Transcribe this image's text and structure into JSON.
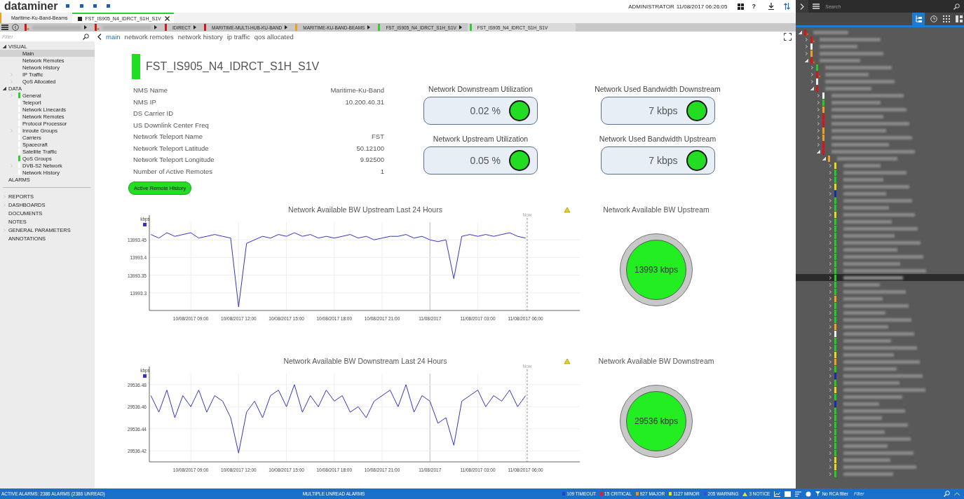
{
  "header": {
    "logo": "dataminer",
    "user": "ADMINISTRATOR",
    "datetime": "11/08/2017 06:26:05",
    "help": "?"
  },
  "tabs": [
    {
      "label": "Maritime-Ku-Band-Beams",
      "color": "#f0a020",
      "selected": false
    },
    {
      "label": "FST_IS905_N4_IDRCT_S1H_S1V",
      "color": "#33cc33",
      "selected": true
    }
  ],
  "breadcrumbs": [
    {
      "color": "#d01818",
      "alarm": true,
      "selected": false
    },
    {
      "color": "#d01818",
      "alarm": true,
      "selected": false
    },
    {
      "label": "IDIRECT",
      "color": "#d01818",
      "alarm": false,
      "selected": false
    },
    {
      "label": "MARITIME-MULTI-HUB-KU-BAND",
      "color": "#d01818",
      "alarm": false,
      "selected": false
    },
    {
      "label": "MARITIME-KU-BAND-BEAMS",
      "color": "#f0a020",
      "alarm": false,
      "selected": false
    },
    {
      "label": "FST_IS905_N4_IDRCT_S1H_S1V",
      "color": "#33cc33",
      "alarm": false,
      "selected": false
    },
    {
      "label": "FST_IS905_N4_IDRCT_S1H_S1V",
      "color": "#33cc33",
      "alarm": false,
      "selected": true
    }
  ],
  "sidebar": {
    "filter": {
      "placeholder": "Filter"
    },
    "tree": [
      {
        "label": "VISUAL",
        "expanded": true,
        "selected": false,
        "children": [
          {
            "label": "Main",
            "expandable": false,
            "selected": true
          },
          {
            "label": "Network Remotes",
            "expandable": false,
            "selected": false
          },
          {
            "label": "Network History",
            "expandable": false,
            "selected": false
          },
          {
            "label": "IP Traffic",
            "expandable": true,
            "selected": false
          },
          {
            "label": "QoS Allocated",
            "expandable": true,
            "selected": false
          }
        ]
      },
      {
        "label": "DATA",
        "expanded": true,
        "selected": false,
        "children": [
          {
            "label": "General",
            "color": "#33cc33",
            "expandable": true,
            "selected": false
          },
          {
            "label": "Teleport",
            "color": "#ffffff",
            "expandable": false,
            "selected": false
          },
          {
            "label": "Network Linecards",
            "color": "#ffffff",
            "expandable": false,
            "selected": false
          },
          {
            "label": "Network Remotes",
            "color": "#ffffff",
            "expandable": false,
            "selected": false
          },
          {
            "label": "Protocol Processor",
            "color": "#ffffff",
            "expandable": false,
            "selected": false
          },
          {
            "label": "Inroute Groups",
            "color": "#ffffff",
            "expandable": true,
            "selected": false
          },
          {
            "label": "Carriers",
            "color": "#ffffff",
            "expandable": false,
            "selected": false
          },
          {
            "label": "Spacecraft",
            "color": "#ffffff",
            "expandable": false,
            "selected": false
          },
          {
            "label": "Satellite Traffic",
            "color": "#ffffff",
            "expandable": false,
            "selected": false
          },
          {
            "label": "QoS Groups",
            "color": "#33cc33",
            "expandable": false,
            "selected": false
          },
          {
            "label": "DVB-S2 Network",
            "color": "#ffffff",
            "expandable": true,
            "selected": false
          },
          {
            "label": "Network History",
            "color": "#ffffff",
            "expandable": false,
            "selected": false
          }
        ]
      },
      {
        "label": "ALARMS",
        "expandable": false,
        "selected": false
      }
    ],
    "sections": [
      {
        "label": "REPORTS",
        "expandable": true,
        "selected": false
      },
      {
        "label": "DASHBOARDS",
        "expandable": true,
        "selected": false
      },
      {
        "label": "DOCUMENTS",
        "expandable": false,
        "selected": false
      },
      {
        "label": "NOTES",
        "expandable": false,
        "selected": false
      },
      {
        "label": "GENERAL PARAMETERS",
        "expandable": true,
        "selected": false
      },
      {
        "label": "ANNOTATIONS",
        "expandable": false,
        "selected": false
      }
    ]
  },
  "page_tabs": [
    {
      "label": "main",
      "selected": true
    },
    {
      "label": "network remotes",
      "selected": false
    },
    {
      "label": "network history",
      "selected": false
    },
    {
      "label": "ip traffic",
      "selected": false
    },
    {
      "label": "qos allocated",
      "selected": false
    }
  ],
  "element": {
    "title": "FST_IS905_N4_IDRCT_S1H_S1V",
    "color": "#22dd22"
  },
  "parameters": [
    {
      "name": "NMS Name",
      "value": "Maritime-Ku-Band"
    },
    {
      "name": "NMS IP",
      "value": "10.200.40.31"
    },
    {
      "name": "DS Carrier ID"
    },
    {
      "name": "US Downlink Center Freq"
    },
    {
      "name": "Network Teleport Name",
      "value": "FST"
    },
    {
      "name": "Network Teleport Latitude",
      "value": "50.12100"
    },
    {
      "name": "Network Teleport Longitude",
      "value": "9.92500"
    },
    {
      "name": "Number of Active Remotes",
      "value": "1"
    }
  ],
  "button": "Active Remote History",
  "readouts": [
    {
      "title": "Network Downstream Utilization",
      "value": "0.02 %",
      "color": "#22dd22"
    },
    {
      "title": "Network Used Bandwidth Downstream",
      "value": "7 kbps",
      "color": "#22dd22"
    },
    {
      "title": "Network Upstream Utilization",
      "value": "0.05 %",
      "color": "#22dd22"
    },
    {
      "title": "Network Used Bandwidth Upstream",
      "value": "7 kbps",
      "color": "#22dd22"
    }
  ],
  "trends": [
    {
      "chart_data": {
        "type": "line",
        "title": "Network Available BW Upstream Last 24 Hours",
        "categories": [
          null,
          null,
          null,
          null,
          null,
          "10/08/2017 09:00",
          null,
          null,
          null,
          null,
          null,
          "10/08/2017 12:00",
          null,
          null,
          null,
          null,
          null,
          "10/08/2017 15:00",
          null,
          null,
          null,
          null,
          null,
          "10/08/2017 18:00",
          null,
          null,
          null,
          null,
          null,
          "10/08/2017 21:00",
          null,
          null,
          null,
          null,
          null,
          "11/08/2017",
          null,
          null,
          null,
          null,
          null,
          "11/08/2017 03:00",
          null,
          null,
          null,
          null,
          null,
          "11/08/2017 06:00"
        ],
        "series": [
          {
            "name": "kbps",
            "color": "#3333cc",
            "values": [
              13993.465,
              13993.455,
              13993.47,
              13993.46,
              13993.465,
              13993.47,
              13993.455,
              13993.46,
              13993.465,
              13993.46,
              13993.455,
              13993.26,
              13993.44,
              13993.45,
              13993.46,
              13993.455,
              13993.465,
              13993.46,
              13993.47,
              13993.46,
              13993.465,
              13993.455,
              13993.46,
              13993.455,
              13993.46,
              13993.465,
              13993.455,
              13993.46,
              13993.45,
              13993.455,
              13993.46,
              13993.46,
              13993.465,
              13993.455,
              13993.46,
              13993.45,
              13993.445,
              13993.45,
              13993.34,
              13993.46,
              13993.465,
              13993.46,
              13993.465,
              13993.46,
              13993.465,
              13993.47,
              13993.46,
              13993.455
            ]
          }
        ],
        "ylim": [
          13993.25,
          13993.5
        ],
        "yticks": [
          13993.3,
          13993.35,
          13993.4,
          13993.45
        ],
        "grid": true,
        "annotations": [
          "Now"
        ]
      }
    },
    {
      "chart_data": {
        "type": "line",
        "title": "Network Available BW Downstream Last 24 Hours",
        "categories": [
          null,
          null,
          null,
          null,
          null,
          "10/08/2017 09:00",
          null,
          null,
          null,
          null,
          null,
          "10/08/2017 12:00",
          null,
          null,
          null,
          null,
          null,
          "10/08/2017 15:00",
          null,
          null,
          null,
          null,
          null,
          "10/08/2017 18:00",
          null,
          null,
          null,
          null,
          null,
          "10/08/2017 21:00",
          null,
          null,
          null,
          null,
          null,
          "11/08/2017",
          null,
          null,
          null,
          null,
          null,
          "11/08/2017 03:00",
          null,
          null,
          null,
          null,
          null,
          "11/08/2017 06:00"
        ],
        "series": [
          {
            "name": "kbps",
            "color": "#3333cc",
            "values": [
              29536.47,
              29536.455,
              29536.475,
              29536.45,
              29536.47,
              29536.46,
              29536.475,
              29536.455,
              29536.47,
              29536.465,
              29536.45,
              29536.418,
              29536.455,
              29536.465,
              29536.45,
              29536.47,
              29536.475,
              29536.46,
              29536.48,
              29536.455,
              29536.47,
              29536.46,
              29536.475,
              29536.465,
              29536.47,
              29536.455,
              29536.46,
              29536.45,
              29536.465,
              29536.47,
              29536.475,
              29536.46,
              29536.48,
              29536.455,
              29536.47,
              29536.465,
              29536.445,
              29536.45,
              29536.425,
              29536.465,
              29536.47,
              29536.475,
              29536.46,
              29536.47,
              29536.465,
              29536.475,
              29536.46,
              29536.47
            ]
          }
        ],
        "ylim": [
          29536.41,
          29536.49
        ],
        "yticks": [
          29536.42,
          29536.44,
          29536.46,
          29536.48
        ],
        "grid": true,
        "annotations": [
          "Now"
        ]
      }
    }
  ],
  "gauges": [
    {
      "title": "Network Available BW Upstream",
      "value": "13993 kbps",
      "color": "#22ee22"
    },
    {
      "title": "Network Available BW Downstream",
      "value": "29536 kbps",
      "color": "#22ee22"
    }
  ],
  "navigator": {
    "search": {
      "placeholder": "Search"
    },
    "tree": [
      {
        "color": "#d01818",
        "alarm": true,
        "expanded": true,
        "selected": false,
        "children": [
          {
            "color": "#d01818",
            "alarm": true,
            "expanded": false,
            "selected": false
          },
          {
            "color": "#f0f0f0",
            "alarm": false,
            "expanded": false,
            "selected": false
          },
          {
            "color": "#f0a020",
            "alarm": false,
            "expanded": false,
            "selected": false
          },
          {
            "color": "#d01818",
            "alarm": true,
            "expanded": true,
            "selected": false,
            "children": [
              {
                "color": "#22cc22",
                "alarm": false,
                "expanded": false,
                "selected": false
              },
              {
                "color": "#d01818",
                "alarm": true,
                "expanded": false,
                "selected": false
              },
              {
                "color": "#f0f0f0",
                "alarm": false,
                "expanded": false,
                "selected": false
              },
              {
                "color": "#d01818",
                "alarm": false,
                "expanded": true,
                "selected": false,
                "children": [
                  {
                    "color": "#f0f0f0",
                    "alarm": false,
                    "expanded": false,
                    "selected": false
                  },
                  {
                    "color": "#22cc22",
                    "alarm": false,
                    "expanded": false,
                    "selected": false
                  },
                  {
                    "color": "#f0a020",
                    "alarm": false,
                    "expanded": false,
                    "selected": false
                  },
                  {
                    "color": "#d01818",
                    "alarm": false,
                    "expanded": false,
                    "selected": false
                  },
                  {
                    "color": "#d01818",
                    "alarm": false,
                    "expanded": false,
                    "selected": false
                  },
                  {
                    "color": "#f0a020",
                    "alarm": false,
                    "expanded": false,
                    "selected": false
                  },
                  {
                    "color": "#f0a020",
                    "alarm": false,
                    "expanded": false,
                    "selected": false
                  },
                  {
                    "color": "#d01818",
                    "alarm": false,
                    "expanded": false,
                    "selected": false
                  },
                  {
                    "color": "#d01818",
                    "alarm": false,
                    "expanded": true,
                    "selected": false,
                    "children": [
                      {
                        "color": "#f0a020",
                        "alarm": false,
                        "expanded": true,
                        "selected": false,
                        "children": [
                          {
                            "color": "#e8d820",
                            "alarm": false,
                            "expanded": false,
                            "selected": false
                          },
                          {
                            "color": "#22cc22",
                            "alarm": false,
                            "expanded": false,
                            "selected": false
                          },
                          {
                            "color": "#22cc22",
                            "alarm": false,
                            "expanded": false,
                            "selected": false
                          },
                          {
                            "color": "#e8d820",
                            "alarm": false,
                            "expanded": false,
                            "selected": false
                          },
                          {
                            "color": "#1030b0",
                            "alarm": false,
                            "expanded": false,
                            "selected": false
                          },
                          {
                            "color": "#22cc22",
                            "alarm": false,
                            "expanded": false,
                            "selected": false
                          },
                          {
                            "color": "#22cc22",
                            "alarm": false,
                            "expanded": false,
                            "selected": false
                          },
                          {
                            "color": "#e8d820",
                            "alarm": false,
                            "expanded": false,
                            "selected": false
                          },
                          {
                            "color": "#22cc22",
                            "alarm": false,
                            "expanded": false,
                            "selected": false
                          },
                          {
                            "color": "#22cc22",
                            "alarm": false,
                            "expanded": false,
                            "selected": false
                          },
                          {
                            "color": "#22cc22",
                            "alarm": false,
                            "expanded": false,
                            "selected": false
                          },
                          {
                            "color": "#22cc22",
                            "alarm": false,
                            "expanded": false,
                            "selected": false
                          },
                          {
                            "color": "#22cc22",
                            "alarm": false,
                            "expanded": false,
                            "selected": false
                          },
                          {
                            "color": "#22cc22",
                            "alarm": false,
                            "expanded": false,
                            "selected": false
                          },
                          {
                            "color": "#22cc22",
                            "alarm": false,
                            "expanded": false,
                            "selected": false
                          },
                          {
                            "color": "#22cc22",
                            "alarm": false,
                            "expanded": false,
                            "selected": false
                          },
                          {
                            "color": "#22cc22",
                            "alarm": false,
                            "expanded": false,
                            "selected": true
                          },
                          {
                            "color": "#22cc22",
                            "alarm": false,
                            "expanded": false,
                            "selected": false
                          },
                          {
                            "color": "#22cc22",
                            "alarm": false,
                            "expanded": false,
                            "selected": false
                          },
                          {
                            "color": "#f0a020",
                            "alarm": false,
                            "expanded": false,
                            "selected": false
                          },
                          {
                            "color": "#22cc22",
                            "alarm": false,
                            "expanded": false,
                            "selected": false
                          },
                          {
                            "color": "#22cc22",
                            "alarm": false,
                            "expanded": false,
                            "selected": false
                          },
                          {
                            "color": "#22cc22",
                            "alarm": false,
                            "expanded": false,
                            "selected": false
                          },
                          {
                            "color": "#f0a020",
                            "alarm": false,
                            "expanded": false,
                            "selected": false
                          },
                          {
                            "color": "#f0f0f0",
                            "alarm": false,
                            "expanded": false,
                            "selected": false
                          },
                          {
                            "color": "#22cc22",
                            "alarm": false,
                            "expanded": false,
                            "selected": false
                          },
                          {
                            "color": "#22cc22",
                            "alarm": false,
                            "expanded": false,
                            "selected": false
                          },
                          {
                            "color": "#e8d820",
                            "alarm": false,
                            "expanded": false,
                            "selected": false
                          },
                          {
                            "color": "#f0a020",
                            "alarm": false,
                            "expanded": false,
                            "selected": false
                          },
                          {
                            "color": "#22cc22",
                            "alarm": false,
                            "expanded": false,
                            "selected": false
                          },
                          {
                            "color": "#1030b0",
                            "alarm": false,
                            "expanded": false,
                            "selected": false
                          },
                          {
                            "color": "#22cc22",
                            "alarm": false,
                            "expanded": false,
                            "selected": false
                          },
                          {
                            "color": "#e8d820",
                            "alarm": false,
                            "expanded": false,
                            "selected": false
                          },
                          {
                            "color": "#22cc22",
                            "alarm": false,
                            "expanded": false,
                            "selected": false
                          },
                          {
                            "color": "#1030b0",
                            "alarm": false,
                            "expanded": false,
                            "selected": false
                          },
                          {
                            "color": "#22cc22",
                            "alarm": false,
                            "expanded": false,
                            "selected": false
                          },
                          {
                            "color": "#22cc22",
                            "alarm": false,
                            "expanded": false,
                            "selected": false
                          },
                          {
                            "color": "#22cc22",
                            "alarm": false,
                            "expanded": false,
                            "selected": false
                          },
                          {
                            "color": "#22cc22",
                            "alarm": false,
                            "expanded": false,
                            "selected": false
                          },
                          {
                            "color": "#22cc22",
                            "alarm": false,
                            "expanded": false,
                            "selected": false
                          },
                          {
                            "color": "#22cc22",
                            "alarm": false,
                            "expanded": false,
                            "selected": false
                          },
                          {
                            "color": "#22cc22",
                            "alarm": false,
                            "expanded": false,
                            "selected": false
                          },
                          {
                            "color": "#e8d820",
                            "alarm": false,
                            "expanded": false,
                            "selected": false
                          },
                          {
                            "color": "#e8d820",
                            "alarm": false,
                            "expanded": false,
                            "selected": false
                          },
                          {
                            "color": "#22cc22",
                            "alarm": false,
                            "expanded": false,
                            "selected": false
                          }
                        ]
                      }
                    ]
                  }
                ]
              }
            ]
          }
        ]
      }
    ]
  },
  "status_bar": {
    "active_alarms": "ACTIVE ALARMS: 2386 ALARMS (2386 UNREAD)",
    "message": "MULTIPLE UNREAD ALARMS",
    "counts": [
      {
        "label": "109 TIMEOUT",
        "color": "#2040d0",
        "kind": "square"
      },
      {
        "label": "15 CRITICAL",
        "color": "#e02020",
        "kind": "square"
      },
      {
        "label": "927 MAJOR",
        "color": "#f09020",
        "kind": "square"
      },
      {
        "label": "1127 MINOR",
        "color": "#f0e020",
        "kind": "square"
      },
      {
        "label": "205 WARNING",
        "color": "#3050e0",
        "kind": "square"
      },
      {
        "label": "3 NOTICE",
        "color": "#f0e020",
        "kind": "triangle"
      }
    ],
    "rca_filter": "No RCA filter",
    "filter": {
      "placeholder": "Filter"
    }
  }
}
